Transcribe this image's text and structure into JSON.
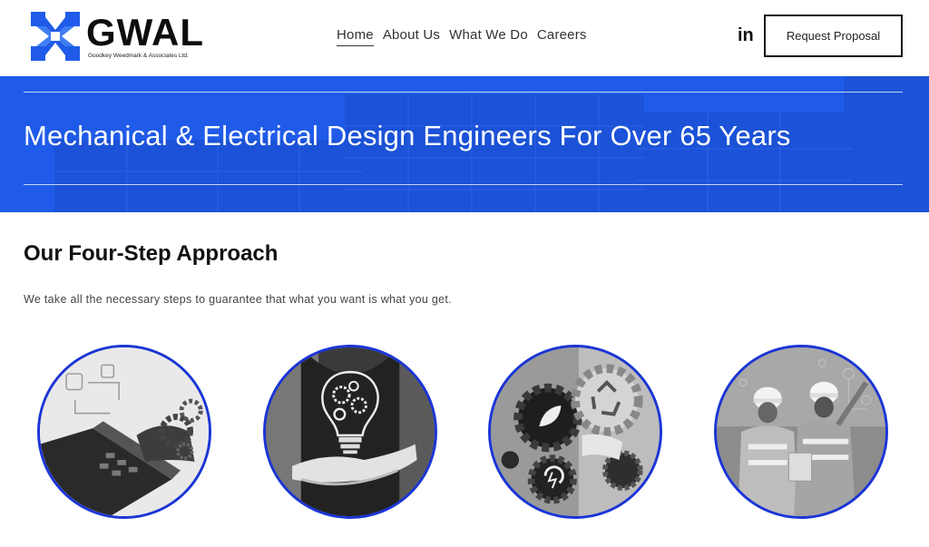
{
  "brand": {
    "name": "GWAL",
    "subtitle": "Goodkey Weedmark & Associates Ltd.",
    "accent": "#1f5be8"
  },
  "nav": {
    "items": [
      "Home",
      "About Us",
      "What We Do",
      "Careers"
    ],
    "active": "Home"
  },
  "header": {
    "social_icon": "linkedin-icon",
    "social_label": "in",
    "cta_label": "Request Proposal"
  },
  "hero": {
    "title": "Mechanical & Electrical Design Engineers For Over 65 Years"
  },
  "approach": {
    "title": "Our Four-Step Approach",
    "description": "We take all the necessary steps to guarantee that what you want is what you get.",
    "images": [
      "laptop-gears-image",
      "lightbulb-gears-image",
      "eco-gears-image",
      "engineers-site-image"
    ]
  }
}
